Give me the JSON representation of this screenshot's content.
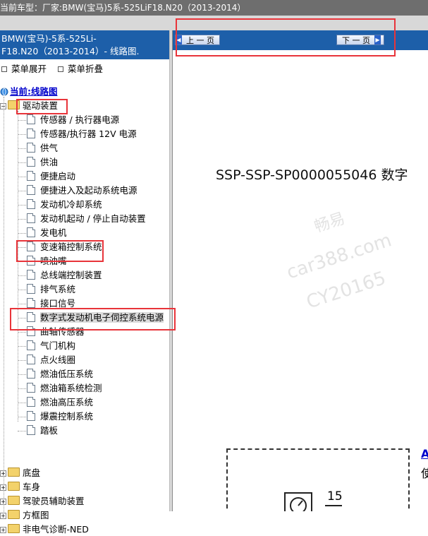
{
  "topbar": {
    "label": "当前车型：",
    "vehicle": "厂家:BMW(宝马)5系-525LiF18.N20（2013-2014）"
  },
  "left": {
    "header_line1": "BMW(宝马)-5系-525Li-",
    "header_line2": "F18.N20（2013-2014）- 线路图.",
    "expand_label": "菜单展开",
    "collapse_label": "菜单折叠",
    "root_label": "当前:线路图",
    "folder_open": "驱动装置",
    "items": [
      "传感器 / 执行器电源",
      "传感器/执行器 12V 电源",
      "供气",
      "供油",
      "便捷启动",
      "便捷进入及起动系统电源",
      "发动机冷却系统",
      "发动机起动 / 停止自动装置",
      "发电机",
      "变速箱控制系统",
      "喷油嘴",
      "总线端控制装置",
      "排气系统",
      "接口信号",
      "数字式发动机电子伺控系统电源",
      "曲轴传感器",
      "气门机构",
      "点火线圈",
      "燃油低压系统",
      "燃油箱系统检测",
      "燃油高压系统",
      "爆震控制系统",
      "踏板"
    ],
    "folders": [
      "底盘",
      "车身",
      "驾驶员辅助装置",
      "方框图",
      "非电气诊断-NED"
    ]
  },
  "right": {
    "prev_label": "上 一 页",
    "next_label": "下 一 页",
    "doc_title": "SSP-SSP-SP0000055046 数字",
    "watermark1": "畅易",
    "watermark2": "car388.com",
    "watermark3": "CY20165",
    "diagram_num": "15",
    "side_label1": "A",
    "side_label2": "使"
  },
  "colors": {
    "header_blue": "#1d5fa9",
    "highlight_red": "#e8343a",
    "topbar_gray": "#6e6e6e"
  }
}
